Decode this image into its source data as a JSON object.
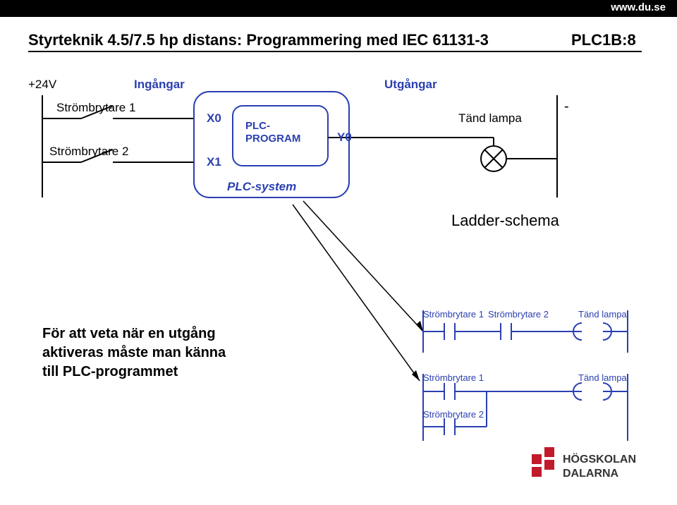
{
  "site": {
    "url": "www.du.se"
  },
  "title": {
    "left": "Styrteknik 4.5/7.5 hp distans: Programmering med IEC 61131-3",
    "right": "PLC1B:8"
  },
  "diagram": {
    "v24": "+24V",
    "inputs_header": "Ingångar",
    "outputs_header": "Utgångar",
    "switch1": "Strömbrytare 1",
    "switch2": "Strömbrytare 2",
    "x0": "X0",
    "x1": "X1",
    "y0": "Y0",
    "plc_program_line1": "PLC-",
    "plc_program_line2": "PROGRAM",
    "plc_system": "PLC-system",
    "lamp_label": "Tänd lampa",
    "minus": "-",
    "ladder_caption": "Ladder-schema"
  },
  "ladder": {
    "sw1": "Strömbrytare 1",
    "sw2": "Strömbrytare 2",
    "lamp": "Tänd lampa"
  },
  "paragraph": {
    "l1": "För att veta när en utgång",
    "l2": "aktiveras måste man känna",
    "l3": "till PLC-programmet"
  },
  "logo": {
    "line1": "HÖGSKOLAN",
    "line2": "DALARNA"
  }
}
